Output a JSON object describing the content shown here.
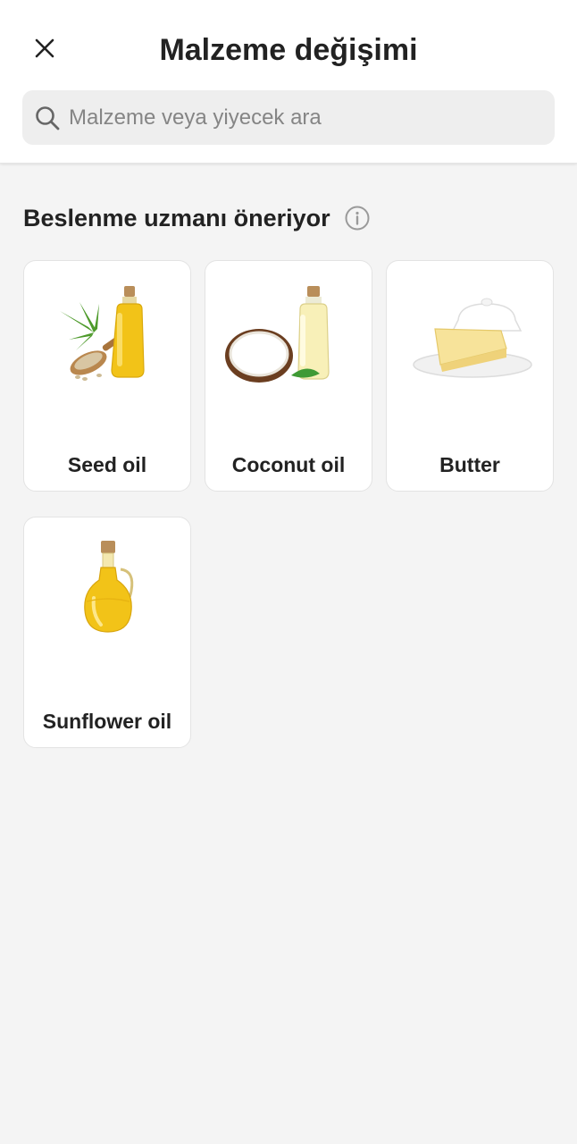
{
  "header": {
    "title": "Malzeme değişimi"
  },
  "search": {
    "placeholder": "Malzeme veya yiyecek ara",
    "value": ""
  },
  "section": {
    "title": "Beslenme uzmanı öneriyor"
  },
  "items": [
    {
      "label": "Seed oil"
    },
    {
      "label": "Coconut oil"
    },
    {
      "label": "Butter"
    },
    {
      "label": "Sunflower oil"
    }
  ],
  "colors": {
    "background": "#f4f4f4",
    "card": "#ffffff",
    "text": "#222222",
    "placeholder": "#858585",
    "oil": "#f2c318"
  }
}
